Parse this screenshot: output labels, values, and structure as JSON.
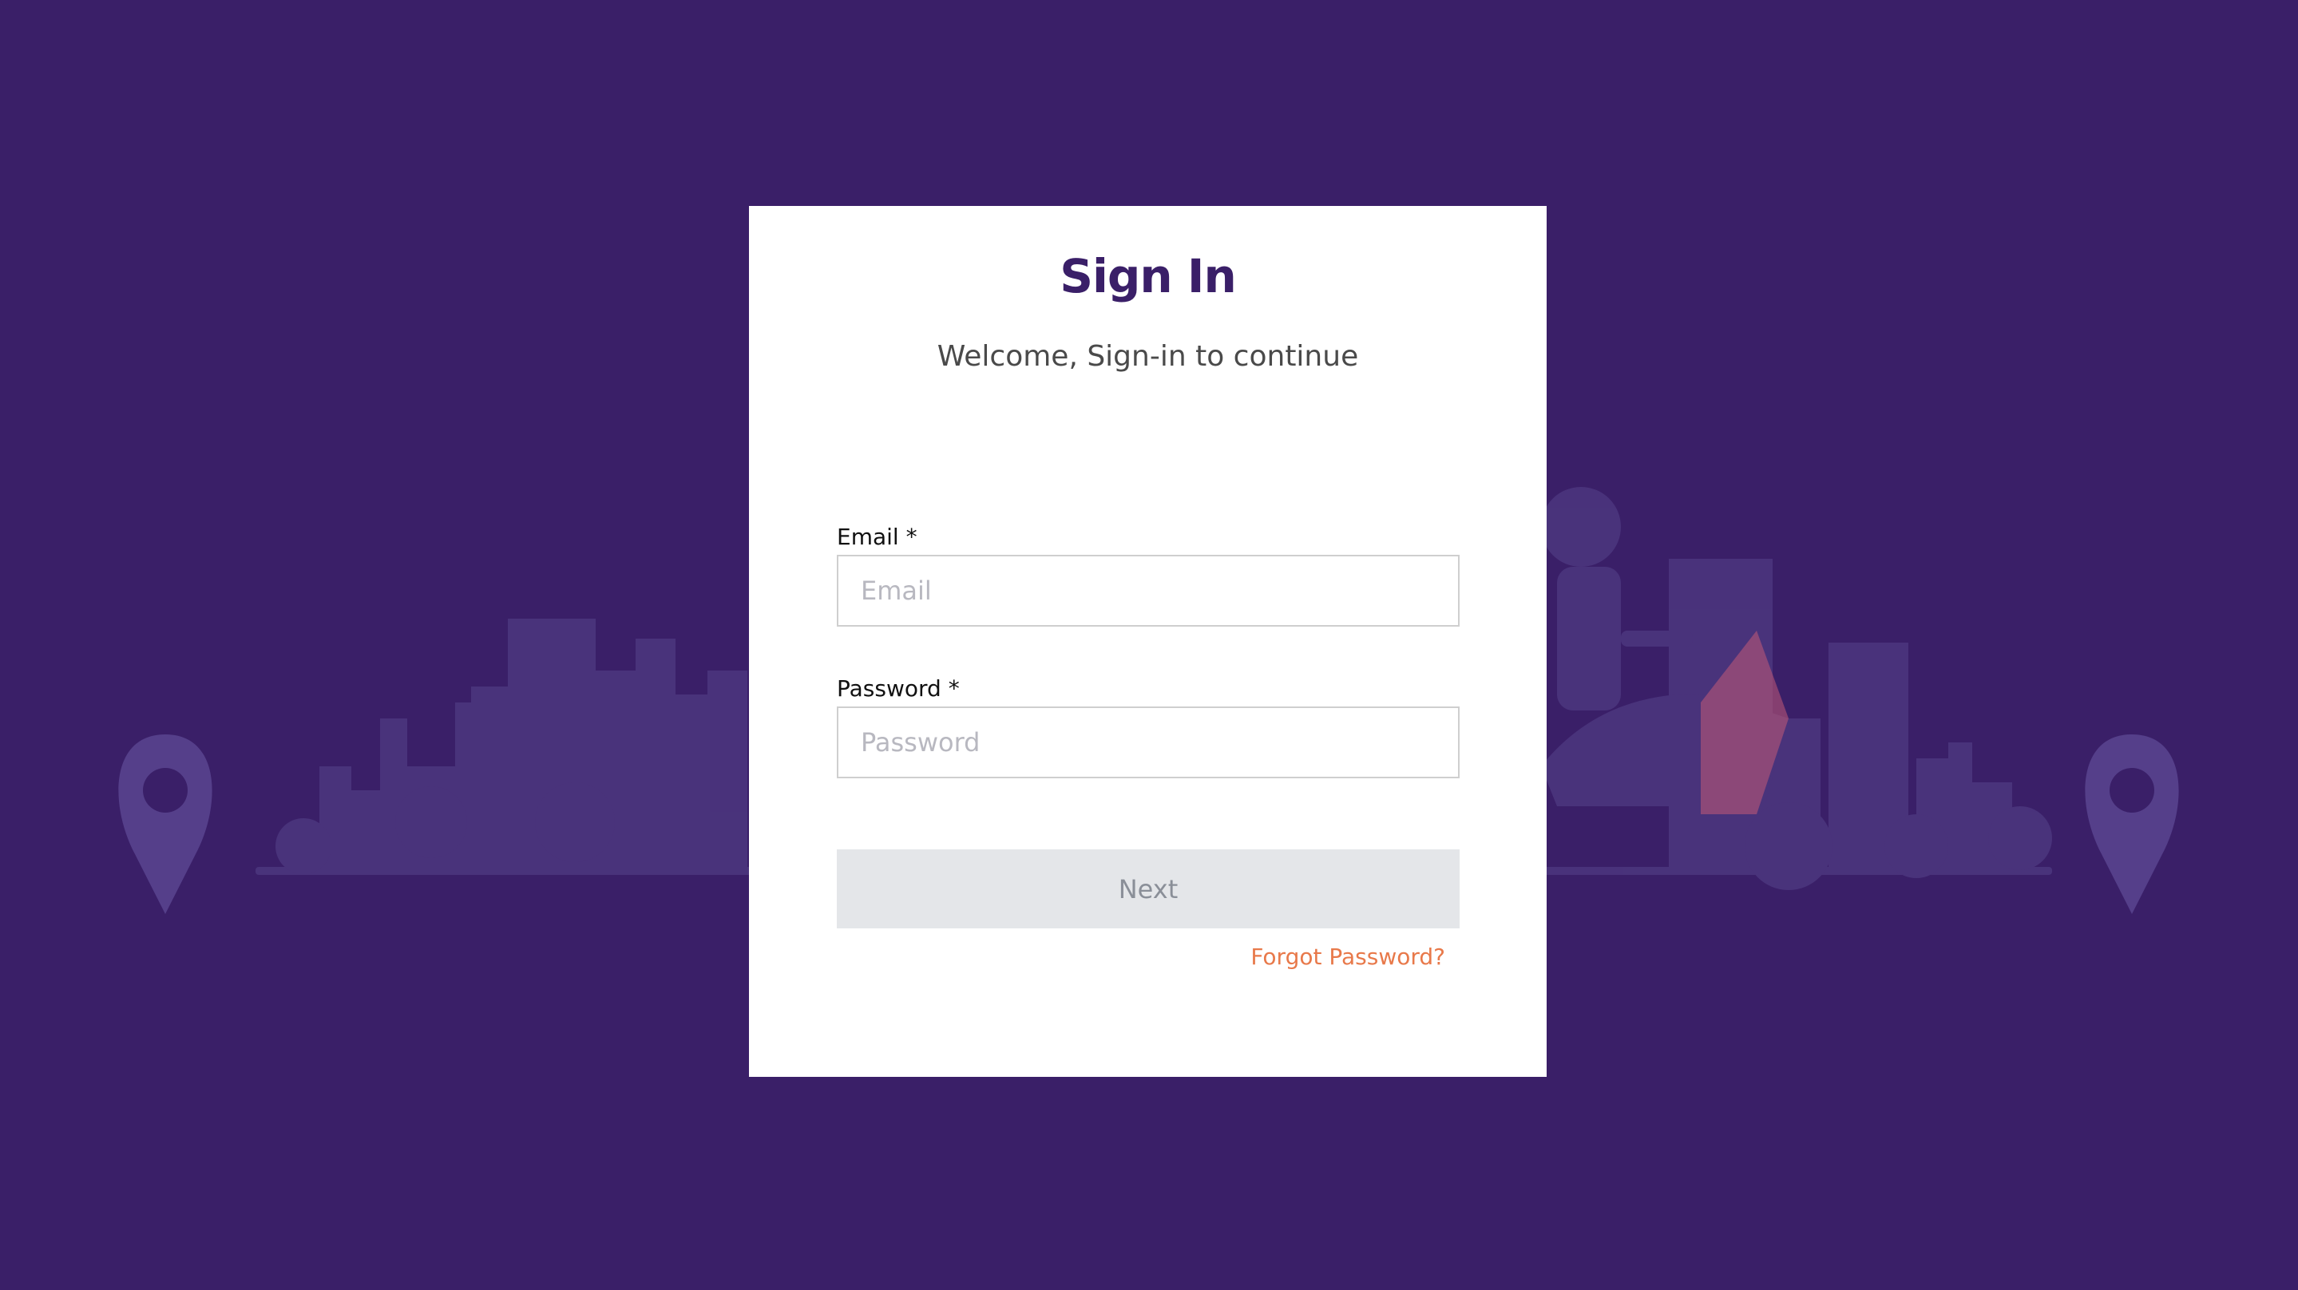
{
  "signin": {
    "title": "Sign In",
    "subtitle": "Welcome, Sign-in to continue",
    "email": {
      "label": "Email",
      "required_mark": "*",
      "placeholder": "Email",
      "value": ""
    },
    "password": {
      "label": "Password",
      "required_mark": "*",
      "placeholder": "Password",
      "value": ""
    },
    "next_label": "Next",
    "forgot_label": "Forgot Password?"
  },
  "background": {
    "left_icon": "map-pin-icon",
    "right_icon": "map-pin-icon",
    "illustration": "city-skyline-with-scooter-rider"
  },
  "colors": {
    "background": "#3a1f68",
    "title": "#3a1f68",
    "link": "#e8794a",
    "button_bg": "#e4e6e9",
    "button_text": "#8a8f98"
  }
}
